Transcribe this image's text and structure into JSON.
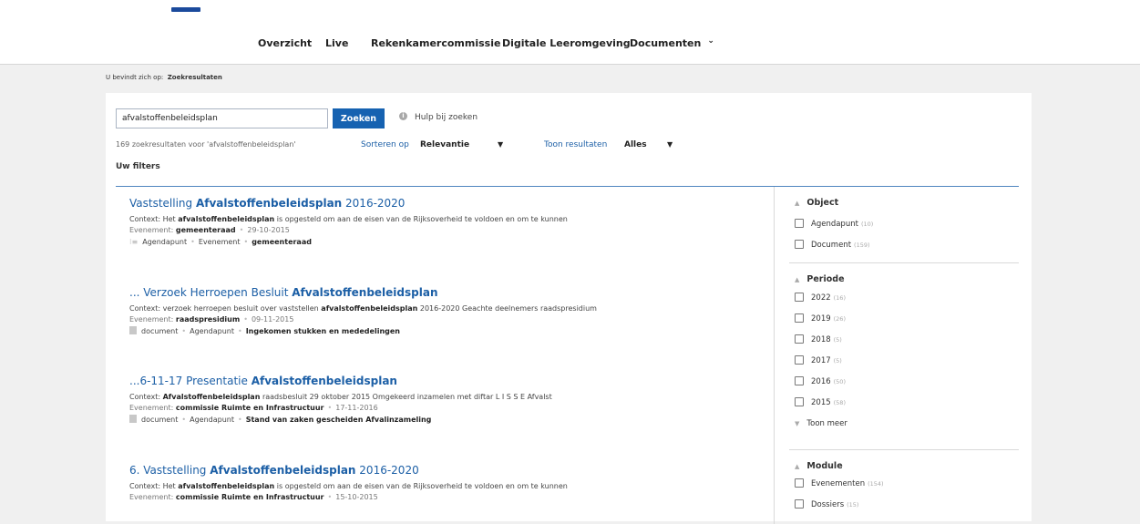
{
  "nav": {
    "items": [
      "Overzicht",
      "Live",
      "Rekenkamercommissie",
      "Digitale Leeromgeving",
      "Documenten"
    ]
  },
  "breadcrumb": {
    "prefix": "U bevindt zich op:",
    "current": "Zoekresultaten"
  },
  "search": {
    "value": "afvalstoffenbeleidsplan",
    "button": "Zoeken",
    "help": "Hulp bij zoeken",
    "count_text": "169 zoekresultaten voor 'afvalstoffenbeleidsplan'",
    "sort_label": "Sorteren op",
    "sort_value": "Relevantie",
    "show_label": "Toon resultaten",
    "show_value": "Alles",
    "filters_label": "Uw filters"
  },
  "results": [
    {
      "title_pre": "Vaststelling ",
      "title_bold": "Afvalstoffenbeleidsplan",
      "title_post": " 2016-2020",
      "ctx_pre": "Context: Het ",
      "ctx_bold": "afvalstoffenbeleidsplan",
      "ctx_post": " is opgesteld om aan de eisen van de Rijksoverheid te voldoen en om te kunnen",
      "ev_label": "Evenement: ",
      "ev_value": "gemeenteraad",
      "date": "29-10-2015",
      "tag1": "Agendapunt",
      "tag2": "Evenement",
      "tag3": "gemeenteraad"
    },
    {
      "title_pre": "... Verzoek Herroepen Besluit ",
      "title_bold": "Afvalstoffenbeleidsplan",
      "title_post": "",
      "ctx_pre": "Context: verzoek herroepen besluit over vaststellen ",
      "ctx_bold": "afvalstoffenbeleidsplan",
      "ctx_post": " 2016-2020 Geachte deelnemers raadspresidium",
      "ev_label": "Evenement: ",
      "ev_value": "raadspresidium",
      "date": "09-11-2015",
      "tag1": "document",
      "tag2": "Agendapunt",
      "tag3": "Ingekomen stukken en mededelingen"
    },
    {
      "title_pre": "...6-11-17 Presentatie ",
      "title_bold": "Afvalstoffenbeleidsplan",
      "title_post": "",
      "ctx_pre": "Context: ",
      "ctx_bold": "Afvalstoffenbeleidsplan",
      "ctx_post": " raadsbesluit 29 oktober 2015 Omgekeerd inzamelen met diftar L I S S E Afvalst",
      "ev_label": "Evenement: ",
      "ev_value": "commissie Ruimte en Infrastructuur",
      "date": "17-11-2016",
      "tag1": "document",
      "tag2": "Agendapunt",
      "tag3": "Stand van zaken gescheiden Afvalinzameling"
    },
    {
      "title_pre": "6. Vaststelling ",
      "title_bold": "Afvalstoffenbeleidsplan",
      "title_post": " 2016-2020",
      "ctx_pre": "Context: Het ",
      "ctx_bold": "afvalstoffenbeleidsplan",
      "ctx_post": " is opgesteld om aan de eisen van de Rijksoverheid te voldoen en om te kunnen",
      "ev_label": "Evenement: ",
      "ev_value": "commissie Ruimte en Infrastructuur",
      "date": "15-10-2015"
    }
  ],
  "facets": {
    "object": {
      "title": "Object",
      "options": [
        {
          "label": "Agendapunt",
          "count": "(10)"
        },
        {
          "label": "Document",
          "count": "(159)"
        }
      ]
    },
    "periode": {
      "title": "Periode",
      "options": [
        {
          "label": "2022",
          "count": "(16)"
        },
        {
          "label": "2019",
          "count": "(26)"
        },
        {
          "label": "2018",
          "count": "(5)"
        },
        {
          "label": "2017",
          "count": "(5)"
        },
        {
          "label": "2016",
          "count": "(50)"
        },
        {
          "label": "2015",
          "count": "(58)"
        }
      ],
      "more": "Toon meer"
    },
    "module": {
      "title": "Module",
      "options": [
        {
          "label": "Evenementen",
          "count": "(154)"
        },
        {
          "label": "Dossiers",
          "count": "(15)"
        }
      ]
    }
  }
}
